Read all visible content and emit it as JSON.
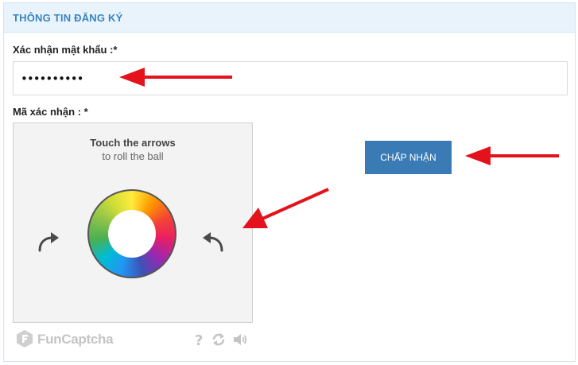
{
  "panel": {
    "title": "THÔNG TIN ĐĂNG KÝ"
  },
  "form": {
    "confirm_password_label": "Xác nhận mật khẩu :*",
    "confirm_password_value": "••••••••••",
    "captcha_label": "Mã xác nhận : *"
  },
  "captcha": {
    "instruction_title": "Touch the arrows",
    "instruction_sub": "to roll the ball",
    "brand": "FunCaptcha",
    "icons": [
      "rotate-left-icon",
      "rotate-right-icon",
      "help-icon",
      "refresh-icon",
      "audio-icon"
    ]
  },
  "submit": {
    "label": "CHẤP NHẬN"
  },
  "colors": {
    "accent": "#3a7bb5",
    "header_bg": "#e9f3fb",
    "annotation": "#e3121b"
  }
}
